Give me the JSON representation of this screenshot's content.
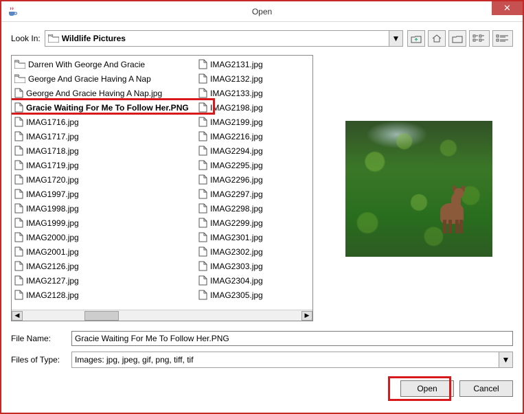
{
  "window": {
    "title": "Open",
    "close_glyph": "✕"
  },
  "lookIn": {
    "label": "Look In:",
    "value": "Wildlife Pictures"
  },
  "toolbar_icons": [
    "up-one-level",
    "home",
    "new-folder",
    "list-view",
    "details-view"
  ],
  "files": {
    "col0": [
      {
        "name": "Darren With George And Gracie",
        "type": "folder"
      },
      {
        "name": "George And Gracie Having A Nap",
        "type": "folder"
      },
      {
        "name": "George And Gracie Having A Nap.jpg",
        "type": "file"
      },
      {
        "name": "Gracie Waiting For Me To Follow Her.PNG",
        "type": "file",
        "selected": true
      },
      {
        "name": "IMAG1716.jpg",
        "type": "file"
      },
      {
        "name": "IMAG1717.jpg",
        "type": "file"
      },
      {
        "name": "IMAG1718.jpg",
        "type": "file"
      },
      {
        "name": "IMAG1719.jpg",
        "type": "file"
      },
      {
        "name": "IMAG1720.jpg",
        "type": "file"
      },
      {
        "name": "IMAG1997.jpg",
        "type": "file"
      },
      {
        "name": "IMAG1998.jpg",
        "type": "file"
      },
      {
        "name": "IMAG1999.jpg",
        "type": "file"
      },
      {
        "name": "IMAG2000.jpg",
        "type": "file"
      },
      {
        "name": "IMAG2001.jpg",
        "type": "file"
      },
      {
        "name": "IMAG2126.jpg",
        "type": "file"
      },
      {
        "name": "IMAG2127.jpg",
        "type": "file"
      },
      {
        "name": "IMAG2128.jpg",
        "type": "file"
      }
    ],
    "col1": [
      {
        "name": "IMAG2131.jpg",
        "type": "file"
      },
      {
        "name": "IMAG2132.jpg",
        "type": "file"
      },
      {
        "name": "IMAG2133.jpg",
        "type": "file"
      },
      {
        "name": "IMAG2198.jpg",
        "type": "file"
      },
      {
        "name": "IMAG2199.jpg",
        "type": "file"
      },
      {
        "name": "IMAG2216.jpg",
        "type": "file"
      },
      {
        "name": "IMAG2294.jpg",
        "type": "file"
      },
      {
        "name": "IMAG2295.jpg",
        "type": "file"
      },
      {
        "name": "IMAG2296.jpg",
        "type": "file"
      },
      {
        "name": "IMAG2297.jpg",
        "type": "file"
      },
      {
        "name": "IMAG2298.jpg",
        "type": "file"
      },
      {
        "name": "IMAG2299.jpg",
        "type": "file"
      },
      {
        "name": "IMAG2301.jpg",
        "type": "file"
      },
      {
        "name": "IMAG2302.jpg",
        "type": "file"
      },
      {
        "name": "IMAG2303.jpg",
        "type": "file"
      },
      {
        "name": "IMAG2304.jpg",
        "type": "file"
      },
      {
        "name": "IMAG2305.jpg",
        "type": "file"
      }
    ]
  },
  "fileName": {
    "label": "File Name:",
    "value": "Gracie Waiting For Me To Follow Her.PNG"
  },
  "fileType": {
    "label": "Files of Type:",
    "value": "Images: jpg, jpeg, gif, png, tiff, tif"
  },
  "buttons": {
    "open": "Open",
    "cancel": "Cancel"
  },
  "colors": {
    "annotation_red": "#d7191c"
  }
}
